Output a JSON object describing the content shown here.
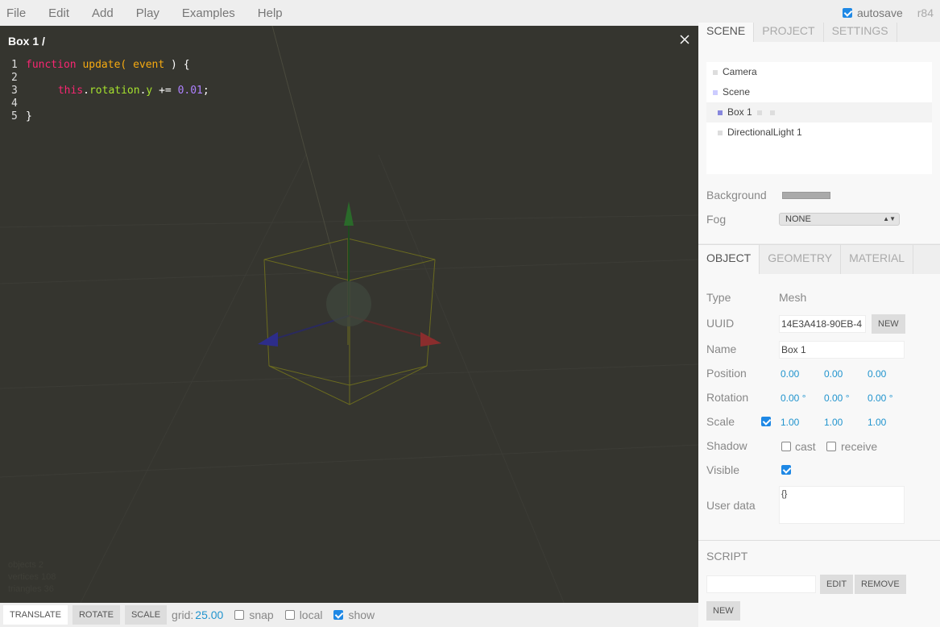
{
  "menubar": {
    "items": [
      "File",
      "Edit",
      "Add",
      "Play",
      "Examples",
      "Help"
    ]
  },
  "autosave": {
    "label": "autosave",
    "checked": true,
    "revision": "r84"
  },
  "script_editor": {
    "title": "Box 1 /",
    "lines": [
      "1",
      "2",
      "3",
      "4",
      "5"
    ],
    "code": {
      "l1_kw": "function",
      "l1_fn": "update(",
      "l1_param": "event",
      "l1_end": ") {",
      "l3_this": "this",
      "l3_dot1": ".",
      "l3_prop1": "rotation",
      "l3_dot2": ".",
      "l3_prop2": "y",
      "l3_op": "+=",
      "l3_num": "0.01",
      "l3_end": ";",
      "l5": "}"
    }
  },
  "viewport_info": {
    "objects": "objects 2",
    "vertices": "vertices 108",
    "triangles": "triangles 36"
  },
  "toolbar": {
    "translate": "TRANSLATE",
    "rotate": "ROTATE",
    "scale": "SCALE",
    "grid_label": "grid:",
    "grid_value": "25.00",
    "snap": "snap",
    "local": "local",
    "show": "show"
  },
  "scene_tabs": [
    "SCENE",
    "PROJECT",
    "SETTINGS"
  ],
  "outliner": [
    {
      "label": "Camera",
      "color": "#dddddd"
    },
    {
      "label": "Scene",
      "color": "#ccccff"
    },
    {
      "label": "Box 1",
      "color": "#8888dd"
    },
    {
      "label": "DirectionalLight 1",
      "color": "#dddddd"
    }
  ],
  "scene_props": {
    "background_label": "Background",
    "background_color": "#aaaaaa",
    "fog_label": "Fog",
    "fog_value": "NONE"
  },
  "object_tabs": [
    "OBJECT",
    "GEOMETRY",
    "MATERIAL"
  ],
  "object": {
    "type_label": "Type",
    "type_value": "Mesh",
    "uuid_label": "UUID",
    "uuid_value": "14E3A418-90EB-4",
    "uuid_new": "NEW",
    "name_label": "Name",
    "name_value": "Box 1",
    "position_label": "Position",
    "position": [
      "0.00",
      "0.00",
      "0.00"
    ],
    "rotation_label": "Rotation",
    "rotation": [
      "0.00 °",
      "0.00 °",
      "0.00 °"
    ],
    "scale_label": "Scale",
    "scale": [
      "1.00",
      "1.00",
      "1.00"
    ],
    "shadow_label": "Shadow",
    "cast": "cast",
    "receive": "receive",
    "visible_label": "Visible",
    "userdata_label": "User data",
    "userdata_value": "{}"
  },
  "script_panel": {
    "title": "SCRIPT",
    "edit": "EDIT",
    "remove": "REMOVE",
    "new": "NEW"
  }
}
